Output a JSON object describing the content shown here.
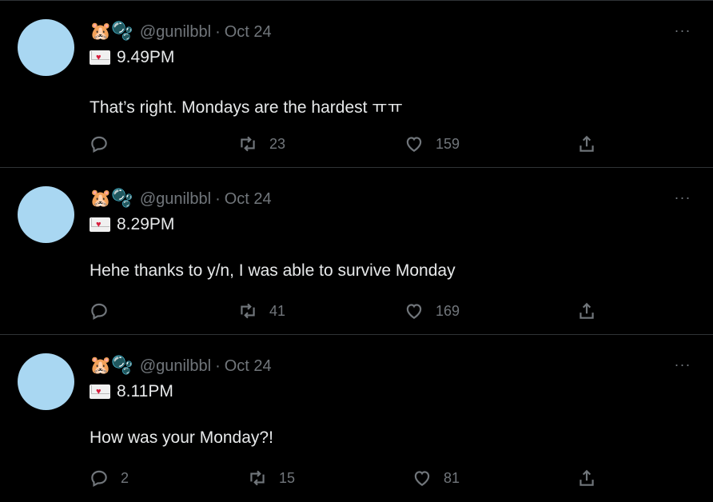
{
  "tweets": [
    {
      "emojis": [
        "🐹",
        "🫧"
      ],
      "handle": "@gunilbbl",
      "separator": "·",
      "date": "Oct 24",
      "time": "9.49PM",
      "text": "That’s right. Mondays are the hardest ㅠㅠ",
      "replies": "",
      "retweets": "23",
      "likes": "159",
      "more": "···"
    },
    {
      "emojis": [
        "🐹",
        "🫧"
      ],
      "handle": "@gunilbbl",
      "separator": "·",
      "date": "Oct 24",
      "time": "8.29PM",
      "text": "Hehe thanks to y/n, I was able to survive Monday",
      "replies": "",
      "retweets": "41",
      "likes": "169",
      "more": "···"
    },
    {
      "emojis": [
        "🐹",
        "🫧"
      ],
      "handle": "@gunilbbl",
      "separator": "·",
      "date": "Oct 24",
      "time": "8.11PM",
      "text": "How was your Monday?!",
      "replies": "2",
      "retweets": "15",
      "likes": "81",
      "more": "···"
    }
  ],
  "colors": {
    "background": "#000000",
    "text": "#e7e9ea",
    "muted": "#71767b",
    "divider": "#2f3336",
    "avatar": "#a9d7f2"
  },
  "icons": {
    "reply": "reply-icon",
    "retweet": "retweet-icon",
    "like": "heart-icon",
    "share": "share-icon",
    "envelope": "love-letter-icon"
  }
}
